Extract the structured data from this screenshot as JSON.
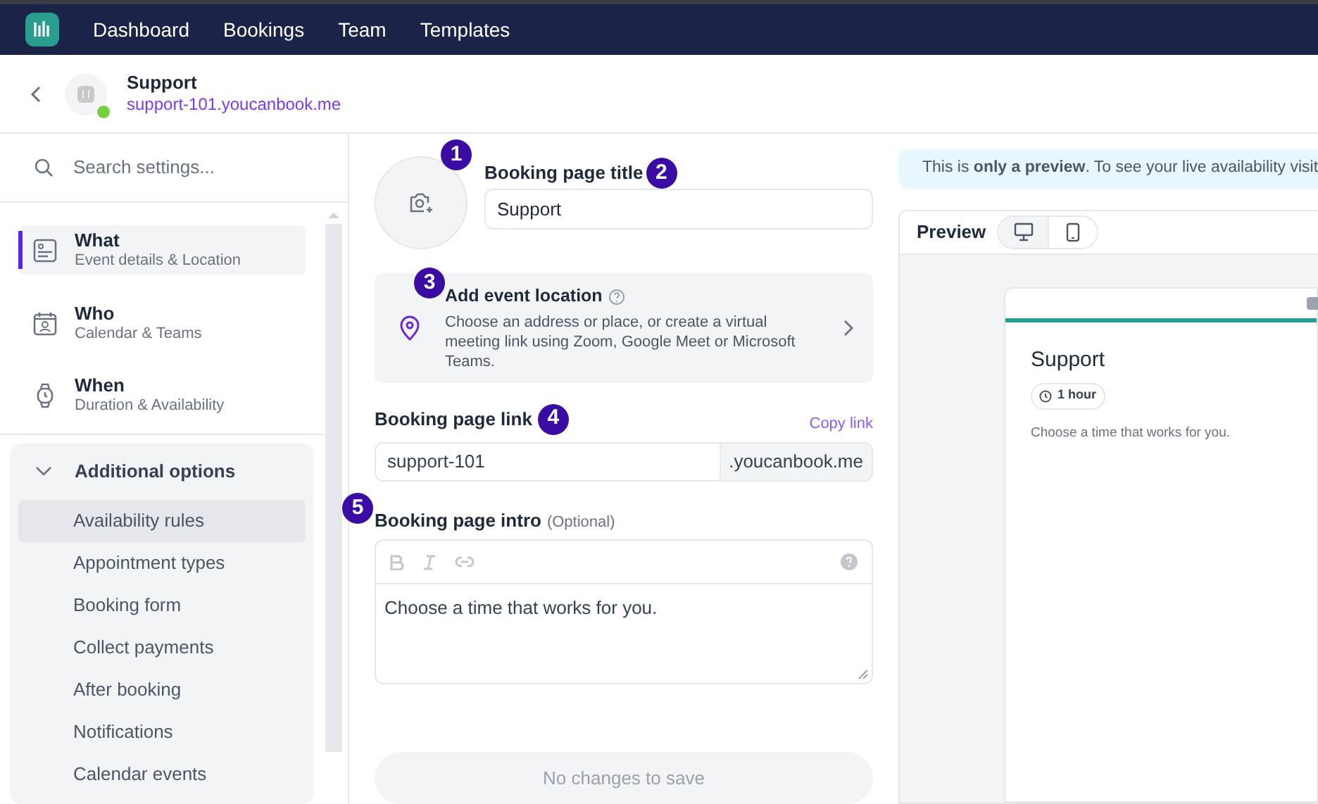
{
  "nav": {
    "items": [
      {
        "label": "Dashboard"
      },
      {
        "label": "Bookings"
      },
      {
        "label": "Team"
      },
      {
        "label": "Templates"
      }
    ]
  },
  "header": {
    "title": "Support",
    "url": "support-101.youcanbook.me",
    "online": true
  },
  "sidebar": {
    "search": {
      "placeholder": "Search settings..."
    },
    "sections": [
      {
        "title": "What",
        "subtitle": "Event details & Location",
        "selected": true
      },
      {
        "title": "Who",
        "subtitle": "Calendar & Teams",
        "selected": false
      },
      {
        "title": "When",
        "subtitle": "Duration & Availability",
        "selected": false
      }
    ],
    "additional_options": {
      "label": "Additional options",
      "expanded": true,
      "items": [
        {
          "label": "Availability rules",
          "selected": true
        },
        {
          "label": "Appointment types",
          "selected": false
        },
        {
          "label": "Booking form",
          "selected": false
        },
        {
          "label": "Collect payments",
          "selected": false
        },
        {
          "label": "After booking",
          "selected": false
        },
        {
          "label": "Notifications",
          "selected": false
        },
        {
          "label": "Calendar events",
          "selected": false
        }
      ]
    }
  },
  "form": {
    "photo": {
      "callout": "1"
    },
    "title": {
      "label": "Booking page title",
      "callout": "2",
      "value": "Support"
    },
    "location": {
      "callout": "3",
      "title": "Add event location",
      "description": "Choose an address or place, or create a virtual meeting link using Zoom, Google Meet or Microsoft Teams."
    },
    "link": {
      "label": "Booking page link",
      "callout": "4",
      "copy": "Copy link",
      "value": "support-101",
      "suffix": ".youcanbook.me"
    },
    "intro": {
      "label": "Booking page intro",
      "callout": "5",
      "optional": "(Optional)",
      "value": "Choose a time that works for you."
    },
    "save_button": {
      "label": "No changes to save",
      "disabled": true
    }
  },
  "preview": {
    "notice": "This is **only a preview**. To see your live availability visit",
    "label": "Preview",
    "devices": [
      {
        "kind": "desktop",
        "selected": true
      },
      {
        "kind": "mobile",
        "selected": false
      }
    ],
    "card": {
      "title": "Support",
      "duration": "1 hour",
      "intro": "Choose a time that works for you."
    }
  }
}
